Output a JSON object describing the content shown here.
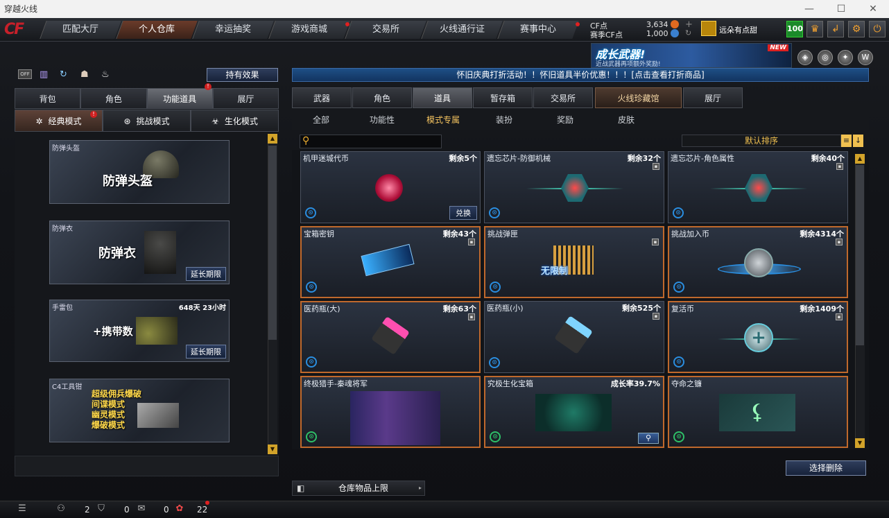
{
  "window": {
    "title": "穿越火线",
    "minimize": "—",
    "maximize": "☐",
    "close": "✕"
  },
  "nav": {
    "logo": "CF",
    "tabs": [
      "匹配大厅",
      "个人仓库",
      "幸运抽奖",
      "游戏商城",
      "交易所",
      "火线通行证",
      "赛事中心"
    ],
    "active": 1
  },
  "currency": {
    "cf_label": "CF点",
    "cf_value": "3,634",
    "season_label": "赛季CF点",
    "season_value": "1,000",
    "user": "远朵有点甜",
    "level": "100"
  },
  "banner": {
    "title": "成长武器!",
    "subtitle": "近战武器再项额外奖励!",
    "badge": "NEW"
  },
  "left": {
    "off_label": "OFF",
    "effects_button": "持有效果",
    "tabs": [
      "背包",
      "角色",
      "功能道具",
      "展厅"
    ],
    "active_tab": 2,
    "modes": [
      "经典模式",
      "挑战模式",
      "生化模式"
    ],
    "active_mode": 0,
    "items": [
      {
        "name": "防弹头盔",
        "art_text": "防弹头盔",
        "extend": ""
      },
      {
        "name": "防弹衣",
        "art_text": "防弹衣",
        "extend": "延长期限"
      },
      {
        "name": "手雷包",
        "time": "648天 23小时",
        "art_text": "+携带数",
        "extend": "延长期限"
      },
      {
        "name": "C4工具钳",
        "art_lines": [
          "超级佣兵爆破",
          "间谍模式",
          "幽灵模式",
          "爆破模式"
        ],
        "extend": ""
      }
    ]
  },
  "notice": "怀旧庆典打折活动！！怀旧道具半价优惠！！！[点击查看打折商品]",
  "right": {
    "tabs": [
      "武器",
      "角色",
      "道具",
      "暂存箱",
      "交易所",
      "火线珍藏馆",
      "展厅"
    ],
    "active_tab": 2,
    "subtabs": [
      "全部",
      "功能性",
      "模式专属",
      "装扮",
      "奖励",
      "皮肤"
    ],
    "active_subtab": 2,
    "search_placeholder": "",
    "sort_label": "默认排序",
    "cards": [
      {
        "name": "机甲迷城代币",
        "count": "剩余5个",
        "button": "兑换"
      },
      {
        "name": "遗忘芯片-防御机械",
        "count": "剩余32个"
      },
      {
        "name": "遗忘芯片-角色属性",
        "count": "剩余40个"
      },
      {
        "name": "宝箱密钥",
        "count": "剩余43个"
      },
      {
        "name": "挑战弹匣",
        "count": "",
        "art_text": "无限制"
      },
      {
        "name": "挑战加入币",
        "count": "剩余4314个"
      },
      {
        "name": "医药瓶(大)",
        "count": "剩余63个"
      },
      {
        "name": "医药瓶(小)",
        "count": "剩余525个"
      },
      {
        "name": "复活币",
        "count": "剩余1409个"
      },
      {
        "name": "终极猎手-秦魂将军",
        "count": ""
      },
      {
        "name": "究极生化宝箱",
        "count": "成长率39.7%"
      },
      {
        "name": "夺命之镰",
        "count": ""
      }
    ],
    "delete_button": "选择删除",
    "limit_button": "仓库物品上限"
  },
  "bottom": {
    "friends": "2",
    "shield": "0",
    "chat": "0",
    "gift": "22"
  }
}
